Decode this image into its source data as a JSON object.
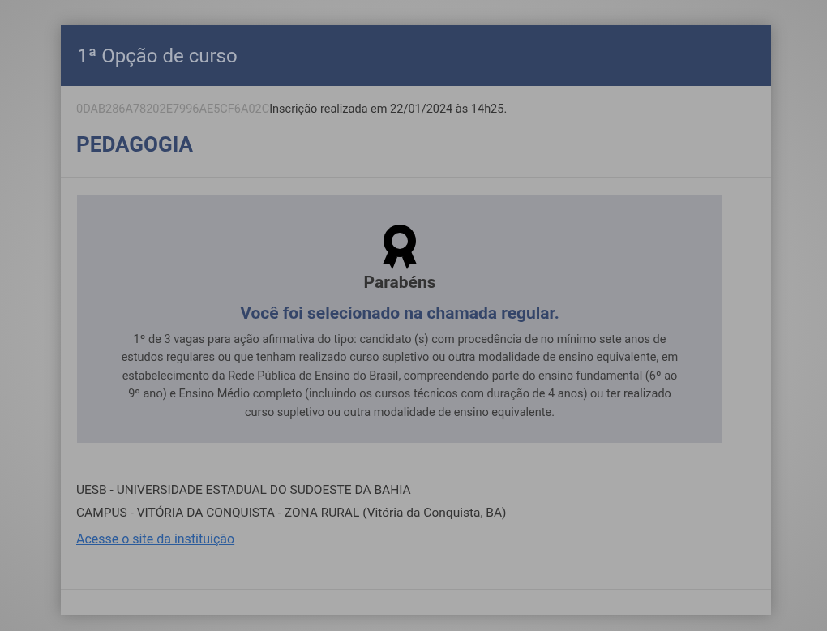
{
  "header": {
    "title": "1ª Opção de curso"
  },
  "registration": {
    "code": "0DAB286A78202E7996AE5CF6A02C",
    "text": "Inscrição realizada em 22/01/2024 às 14h25."
  },
  "course": "PEDAGOGIA",
  "result": {
    "heading": "Parabéns",
    "message": "Você foi selecionado na chamada regular.",
    "details": "1º de 3 vagas para ação afirmativa do tipo: candidato (s) com procedência de no mínimo sete anos de estudos regulares ou que tenham realizado curso supletivo ou outra modalidade de ensino equivalente, em estabelecimento da Rede Pública de Ensino do Brasil, compreendendo parte do ensino fundamental (6º ao 9º ano) e Ensino Médio completo (incluindo os cursos técnicos com duração de 4 anos) ou ter realizado curso supletivo ou outra modalidade de ensino equivalente."
  },
  "institution": {
    "name": "UESB - UNIVERSIDADE ESTADUAL DO SUDOESTE DA BAHIA",
    "campus": "CAMPUS - VITÓRIA DA CONQUISTA - ZONA RURAL (Vitória da Conquista, BA)",
    "link": "Acesse o site da instituição"
  }
}
